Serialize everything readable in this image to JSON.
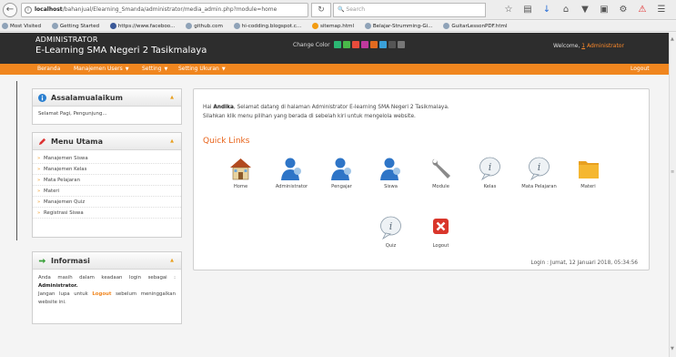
{
  "browser": {
    "url_host": "localhost",
    "url_path": "/bahanjual/Elearning_Smanda/administrator/media_admin.php?module=home",
    "search_placeholder": "Search",
    "bookmarks": [
      "Most Visited",
      "Getting Started",
      "https://www.faceboo...",
      "github.com",
      "hi-codding.blogspot.c...",
      "sitemap.html",
      "Belajar-Strumming-Gi...",
      "GuitarLessonPDF.html"
    ]
  },
  "header": {
    "brand_line1": "ADMINISTRATOR",
    "brand_line2": "E-Learning SMA Negeri 2 Tasikmalaya",
    "change_color_label": "Change Color",
    "swatches": [
      "#2bb673",
      "#49b849",
      "#e74c3c",
      "#c0399e",
      "#e26a1f",
      "#3aa0d8",
      "#555555",
      "#777777"
    ],
    "welcome_prefix": "Welcome,",
    "welcome_num": "1",
    "welcome_user": "Administrator"
  },
  "nav": {
    "items": [
      "Beranda",
      "Manajemen Users",
      "Setting",
      "Setting Ukuran"
    ],
    "logout": "Logout"
  },
  "sidebar": {
    "salam": {
      "title": "Assalamualaikum",
      "body": "Selamat Pagi, Pengunjung..."
    },
    "menu": {
      "title": "Menu Utama",
      "items": [
        "Manajemen Siswa",
        "Manajemen Kelas",
        "Mata Pelajaran",
        "Materi",
        "Manajemen Quiz",
        "Registrasi Siswa"
      ]
    },
    "info": {
      "title": "Informasi",
      "text1": "Anda masih dalam keadaan login sebagai :",
      "role": "Administrator.",
      "text2": "Jangan lupa untuk",
      "logout_word": "Logout",
      "text3": "sebelum meninggalkan website ini."
    }
  },
  "main": {
    "greet_prefix": "Hai",
    "greet_name": "Andika",
    "greet_rest": ", Selamat datang di halaman Administrator E-learning SMA Negeri 2 Tasikmalaya.",
    "greet_line2": "Silahkan klik menu pilihan yang berada di sebelah kiri untuk mengelola website.",
    "quick_links_title": "Quick Links",
    "tiles": [
      {
        "label": "Home",
        "icon": "home-icon"
      },
      {
        "label": "Administrator",
        "icon": "user-icon"
      },
      {
        "label": "Pengajar",
        "icon": "user-icon"
      },
      {
        "label": "Siswa",
        "icon": "user-icon"
      },
      {
        "label": "Module",
        "icon": "wrench-icon"
      },
      {
        "label": "Kelas",
        "icon": "info-bubble-icon"
      },
      {
        "label": "Mata Pelajaran",
        "icon": "info-bubble-icon"
      },
      {
        "label": "Materi",
        "icon": "folder-icon"
      },
      {
        "label": "Quiz",
        "icon": "info-bubble-icon"
      },
      {
        "label": "Logout",
        "icon": "close-icon"
      }
    ],
    "login_info": "Login : Jumat, 12 Januari 2018, 05:34:56"
  }
}
